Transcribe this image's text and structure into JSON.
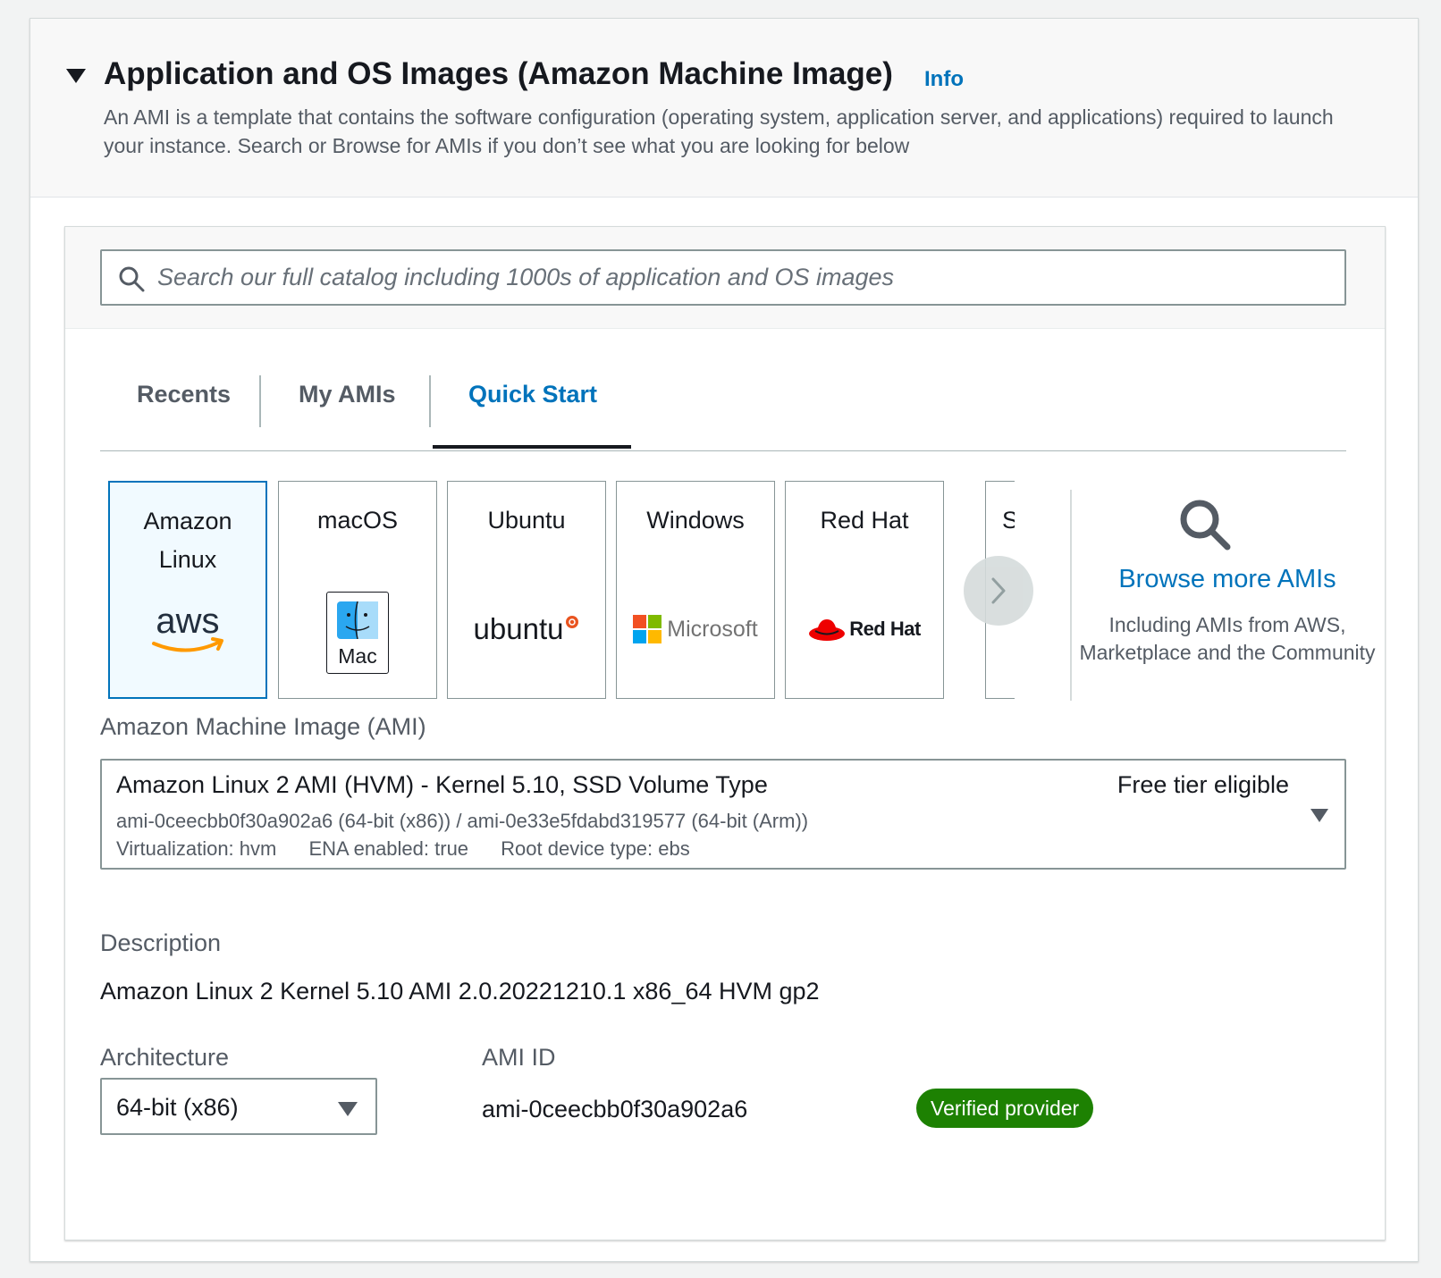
{
  "section": {
    "title": "Application and OS Images (Amazon Machine Image)",
    "info_link": "Info",
    "description": "An AMI is a template that contains the software configuration (operating system, application server, and applications) required to launch your instance. Search or Browse for AMIs if you don’t see what you are looking for below"
  },
  "search": {
    "placeholder": "Search our full catalog including 1000s of application and OS images"
  },
  "tabs": [
    {
      "label": "Recents",
      "active": false
    },
    {
      "label": "My AMIs",
      "active": false
    },
    {
      "label": "Quick Start",
      "active": true
    }
  ],
  "os_cards": [
    {
      "label": "Amazon Linux",
      "logo_text": "aws",
      "selected": true
    },
    {
      "label": "macOS",
      "logo_text": "Mac",
      "selected": false
    },
    {
      "label": "Ubuntu",
      "logo_text": "ubuntu",
      "selected": false
    },
    {
      "label": "Windows",
      "logo_text": "Microsoft",
      "selected": false
    },
    {
      "label": "Red Hat",
      "logo_text": "Red Hat",
      "selected": false
    },
    {
      "label": "S",
      "selected": false
    }
  ],
  "browse": {
    "link": "Browse more AMIs",
    "subtitle": "Including AMIs from AWS, Marketplace and the Community"
  },
  "ami": {
    "label": "Amazon Machine Image (AMI)",
    "name": "Amazon Linux 2 AMI (HVM) - Kernel 5.10, SSD Volume Type",
    "free_tier": "Free tier eligible",
    "ids": "ami-0ceecbb0f30a902a6 (64-bit (x86)) / ami-0e33e5fdabd319577 (64-bit (Arm))",
    "virtualization": "Virtualization: hvm",
    "ena": "ENA enabled: true",
    "root_device": "Root device type: ebs"
  },
  "details": {
    "description_label": "Description",
    "description_value": "Amazon Linux 2 Kernel 5.10 AMI 2.0.20221210.1 x86_64 HVM gp2",
    "architecture_label": "Architecture",
    "architecture_value": "64-bit (x86)",
    "ami_id_label": "AMI ID",
    "ami_id_value": "ami-0ceecbb0f30a902a6",
    "badge": "Verified provider"
  },
  "colors": {
    "link": "#0073bb",
    "selected_bg": "#f1faff",
    "badge_green": "#1d8102"
  }
}
